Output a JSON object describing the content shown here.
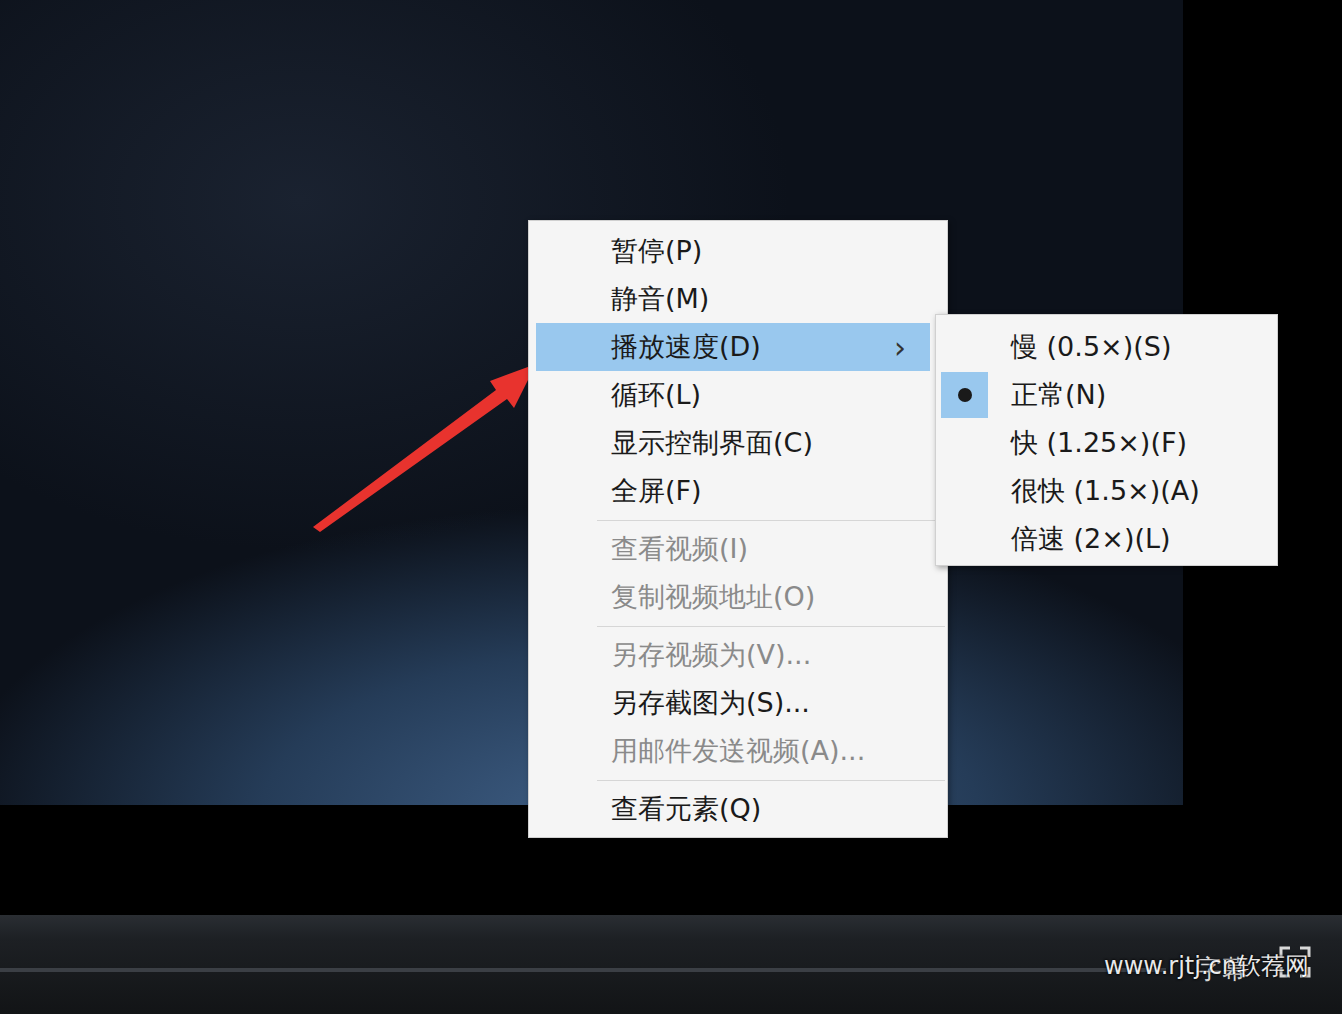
{
  "context_menu": {
    "items": [
      {
        "kind": "item",
        "label": "暂停(P)",
        "disabled": false,
        "highlighted": false,
        "has_submenu": false
      },
      {
        "kind": "item",
        "label": "静音(M)",
        "disabled": false,
        "highlighted": false,
        "has_submenu": false
      },
      {
        "kind": "item",
        "label": "播放速度(D)",
        "disabled": false,
        "highlighted": true,
        "has_submenu": true
      },
      {
        "kind": "item",
        "label": "循环(L)",
        "disabled": false,
        "highlighted": false,
        "has_submenu": false
      },
      {
        "kind": "item",
        "label": "显示控制界面(C)",
        "disabled": false,
        "highlighted": false,
        "has_submenu": false
      },
      {
        "kind": "item",
        "label": "全屏(F)",
        "disabled": false,
        "highlighted": false,
        "has_submenu": false
      },
      {
        "kind": "separator"
      },
      {
        "kind": "item",
        "label": "查看视频(I)",
        "disabled": true,
        "highlighted": false,
        "has_submenu": false
      },
      {
        "kind": "item",
        "label": "复制视频地址(O)",
        "disabled": true,
        "highlighted": false,
        "has_submenu": false
      },
      {
        "kind": "separator"
      },
      {
        "kind": "item",
        "label": "另存视频为(V)...",
        "disabled": true,
        "highlighted": false,
        "has_submenu": false
      },
      {
        "kind": "item",
        "label": "另存截图为(S)...",
        "disabled": false,
        "highlighted": false,
        "has_submenu": false
      },
      {
        "kind": "item",
        "label": "用邮件发送视频(A)...",
        "disabled": true,
        "highlighted": false,
        "has_submenu": false
      },
      {
        "kind": "separator"
      },
      {
        "kind": "item",
        "label": "查看元素(Q)",
        "disabled": false,
        "highlighted": false,
        "has_submenu": false
      }
    ],
    "submenu_arrow": "›"
  },
  "speed_menu": {
    "items": [
      {
        "label": "慢 (0.5×)(S)",
        "selected": false
      },
      {
        "label": "正常(N)",
        "selected": true
      },
      {
        "label": "快 (1.25×)(F)",
        "selected": false
      },
      {
        "label": "很快 (1.5×)(A)",
        "selected": false
      },
      {
        "label": "倍速 (2×)(L)",
        "selected": false
      }
    ]
  },
  "control_bar": {
    "subtitles_label": "字幕"
  },
  "watermark": "www.rjtj.cn软荐网"
}
